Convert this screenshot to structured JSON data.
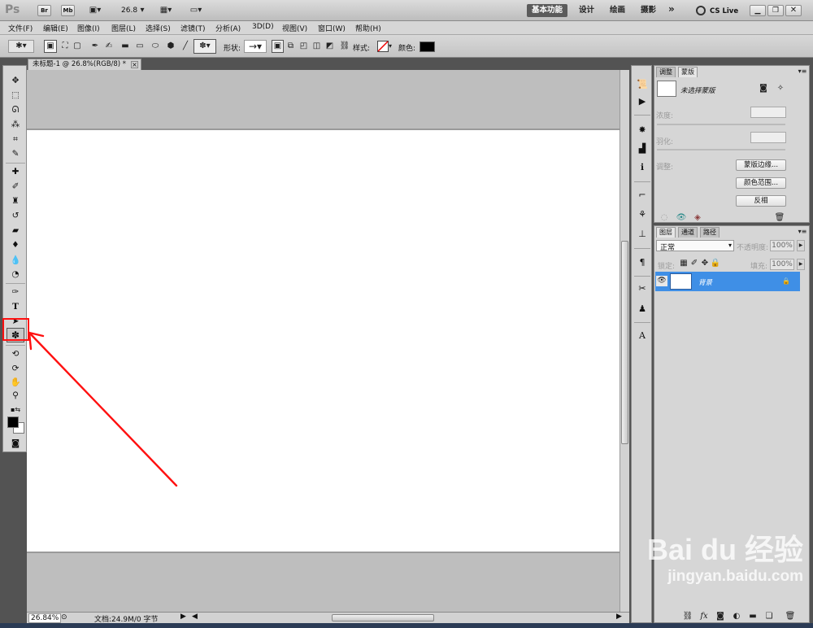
{
  "app": {
    "logo": "Ps",
    "br_label": "Br",
    "mb_label": "Mb",
    "zoom": "26.8",
    "workspaces": [
      "基本功能",
      "设计",
      "绘画",
      "摄影"
    ],
    "more": "»",
    "cslive": "CS Live"
  },
  "menu": [
    "文件(F)",
    "编辑(E)",
    "图像(I)",
    "图层(L)",
    "选择(S)",
    "滤镜(T)",
    "分析(A)",
    "3D(D)",
    "视图(V)",
    "窗口(W)",
    "帮助(H)"
  ],
  "options": {
    "shape_label": "形状:",
    "style_label": "样式:",
    "color_label": "颜色:",
    "color_value": "#000000"
  },
  "document": {
    "tab_title": "未标题-1 @ 26.8%(RGB/8) *",
    "close": "×",
    "canvas_color": "#ffffff"
  },
  "status": {
    "zoom": "26.84%",
    "doc_info": "文档:24.9M/0 字节"
  },
  "adjust_panel": {
    "tabs": [
      "调整",
      "蒙版"
    ],
    "mask_title": "未选择蒙版",
    "density_label": "浓度:",
    "feather_label": "羽化:",
    "refine_label": "调整:",
    "btn_edge": "蒙版边缘...",
    "btn_color_range": "颜色范围...",
    "btn_invert": "反相"
  },
  "layers_panel": {
    "tabs": [
      "图层",
      "通道",
      "路径"
    ],
    "blend_mode": "正常",
    "opacity_label": "不透明度:",
    "opacity_value": "100%",
    "lock_label": "锁定:",
    "fill_label": "填充:",
    "fill_value": "100%",
    "layer_name": "背景",
    "selected_color": "#3f8fe6"
  },
  "annotation": {
    "color": "#ff0000"
  },
  "watermark": {
    "brand": "Bai du 经验",
    "url": "jingyan.baidu.com"
  }
}
